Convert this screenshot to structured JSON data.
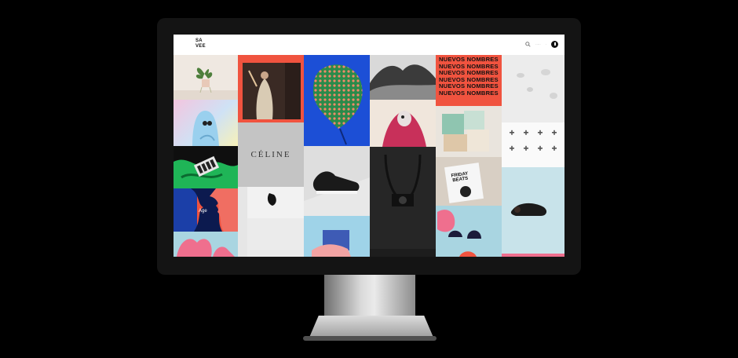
{
  "app": {
    "logo": "SA VEE",
    "logo_line1": "SA",
    "logo_line2": "VEE"
  },
  "nav": {
    "links": [
      "·····",
      "·"
    ],
    "icons": [
      "search-icon",
      "profile-icon"
    ]
  },
  "tiles": {
    "celine_text": "CÉLINE",
    "nuevos_lines": [
      "NUEVOS NOMBRES",
      "NUEVOS NOMBRES",
      "NUEVOS NOMBRES",
      "NUEVOS NOMBRES",
      "NUEVOS NOMBRES",
      "NUEVOS NOMBRES"
    ],
    "friday_line1": "FRIDAY",
    "friday_line2": "BEATS",
    "age_text": "Age"
  },
  "colors": {
    "background": "#000000",
    "bezel": "#141414",
    "orange_red": "#f0533f",
    "blue": "#1c4fd6",
    "green": "#1fb557",
    "pink": "#ef8ab8",
    "light_blue": "#a9d5e1"
  }
}
